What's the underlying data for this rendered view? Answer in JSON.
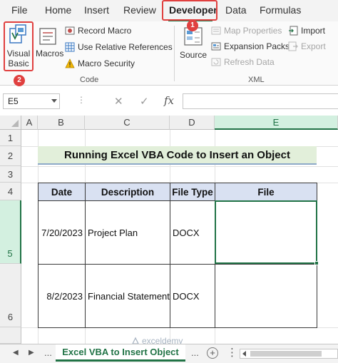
{
  "ribbon_tabs": [
    "File",
    "Home",
    "Insert",
    "Review",
    "Developer",
    "Data",
    "Formulas"
  ],
  "active_tab": "Developer",
  "badges": {
    "developer": "1",
    "visual_basic": "2"
  },
  "code_group": {
    "label": "Code",
    "visual_basic": "Visual Basic",
    "macros": "Macros",
    "record_macro": "Record Macro",
    "use_relative_references": "Use Relative References",
    "macro_security": "Macro Security"
  },
  "xml_group": {
    "label": "XML",
    "source": "Source",
    "map_properties": "Map Properties",
    "expansion_packs": "Expansion Packs",
    "refresh_data": "Refresh Data",
    "import": "Import",
    "export": "Export"
  },
  "formula_bar": {
    "name_box": "E5",
    "dots": "⋮",
    "fx": "fx",
    "value": ""
  },
  "columns": [
    "A",
    "B",
    "C",
    "D",
    "E"
  ],
  "rows": [
    "1",
    "2",
    "3",
    "4",
    "5",
    "6"
  ],
  "sheet": {
    "title": "Running Excel VBA Code to Insert an Object",
    "headers": [
      "Date",
      "Description",
      "File Type",
      "File"
    ],
    "rows": [
      {
        "date": "7/20/2023",
        "description": "Project Plan",
        "file_type": "DOCX",
        "file": ""
      },
      {
        "date": "8/2/2023",
        "description": "Financial Statement",
        "file_type": "DOCX",
        "file": ""
      }
    ]
  },
  "sheet_tabs": {
    "more": "...",
    "active": "Excel VBA to Insert Object",
    "add": "+"
  },
  "watermark": "exceldemy",
  "colors": {
    "excel_green": "#217346",
    "highlight_red": "#e0403f",
    "header_blue": "#d9e1f2",
    "title_green": "#e2efda"
  }
}
